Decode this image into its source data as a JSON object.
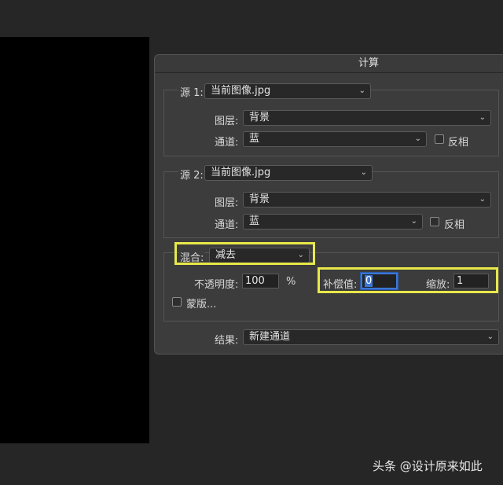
{
  "dialog": {
    "title": "计算",
    "source1": {
      "label": "源 1:",
      "file": "当前图像.jpg",
      "layer_label": "图层:",
      "layer_value": "背景",
      "channel_label": "通道:",
      "channel_value": "蓝",
      "invert_label": "反相",
      "invert_checked": false
    },
    "source2": {
      "label": "源 2:",
      "file": "当前图像.jpg",
      "layer_label": "图层:",
      "layer_value": "背景",
      "channel_label": "通道:",
      "channel_value": "蓝",
      "invert_label": "反相",
      "invert_checked": false
    },
    "blending": {
      "label": "混合:",
      "mode": "减去",
      "opacity_label": "不透明度:",
      "opacity_value": "100",
      "opacity_unit": "%",
      "offset_label": "补偿值:",
      "offset_value": "0",
      "scale_label": "缩放:",
      "scale_value": "1",
      "mask_label": "蒙版...",
      "mask_checked": false
    },
    "result": {
      "label": "结果:",
      "value": "新建通道"
    }
  },
  "annotations": {
    "highlight_color": "#e8e84a"
  },
  "watermark": {
    "text": "头条 @设计原来如此"
  }
}
